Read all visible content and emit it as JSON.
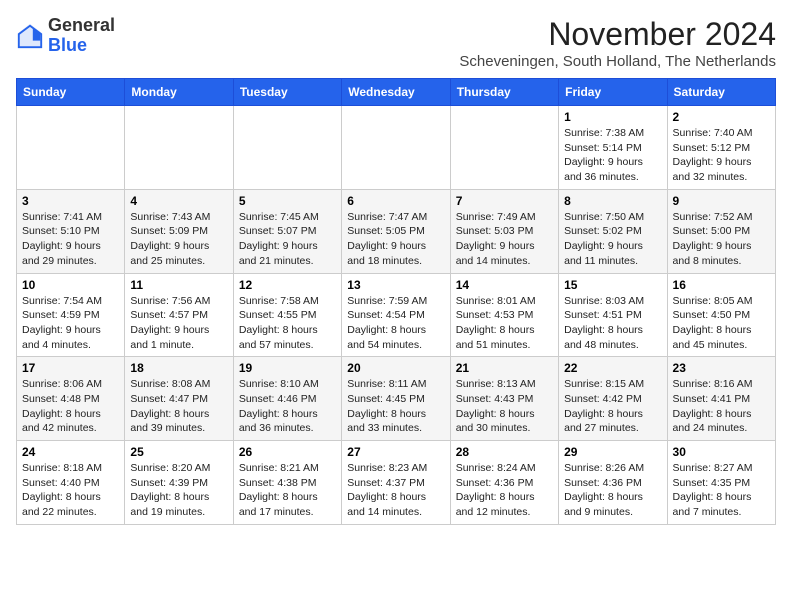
{
  "logo": {
    "line1": "General",
    "line2": "Blue"
  },
  "title": "November 2024",
  "location": "Scheveningen, South Holland, The Netherlands",
  "weekdays": [
    "Sunday",
    "Monday",
    "Tuesday",
    "Wednesday",
    "Thursday",
    "Friday",
    "Saturday"
  ],
  "weeks": [
    [
      {
        "day": "",
        "sunrise": "",
        "sunset": "",
        "daylight": ""
      },
      {
        "day": "",
        "sunrise": "",
        "sunset": "",
        "daylight": ""
      },
      {
        "day": "",
        "sunrise": "",
        "sunset": "",
        "daylight": ""
      },
      {
        "day": "",
        "sunrise": "",
        "sunset": "",
        "daylight": ""
      },
      {
        "day": "",
        "sunrise": "",
        "sunset": "",
        "daylight": ""
      },
      {
        "day": "1",
        "sunrise": "Sunrise: 7:38 AM",
        "sunset": "Sunset: 5:14 PM",
        "daylight": "Daylight: 9 hours and 36 minutes."
      },
      {
        "day": "2",
        "sunrise": "Sunrise: 7:40 AM",
        "sunset": "Sunset: 5:12 PM",
        "daylight": "Daylight: 9 hours and 32 minutes."
      }
    ],
    [
      {
        "day": "3",
        "sunrise": "Sunrise: 7:41 AM",
        "sunset": "Sunset: 5:10 PM",
        "daylight": "Daylight: 9 hours and 29 minutes."
      },
      {
        "day": "4",
        "sunrise": "Sunrise: 7:43 AM",
        "sunset": "Sunset: 5:09 PM",
        "daylight": "Daylight: 9 hours and 25 minutes."
      },
      {
        "day": "5",
        "sunrise": "Sunrise: 7:45 AM",
        "sunset": "Sunset: 5:07 PM",
        "daylight": "Daylight: 9 hours and 21 minutes."
      },
      {
        "day": "6",
        "sunrise": "Sunrise: 7:47 AM",
        "sunset": "Sunset: 5:05 PM",
        "daylight": "Daylight: 9 hours and 18 minutes."
      },
      {
        "day": "7",
        "sunrise": "Sunrise: 7:49 AM",
        "sunset": "Sunset: 5:03 PM",
        "daylight": "Daylight: 9 hours and 14 minutes."
      },
      {
        "day": "8",
        "sunrise": "Sunrise: 7:50 AM",
        "sunset": "Sunset: 5:02 PM",
        "daylight": "Daylight: 9 hours and 11 minutes."
      },
      {
        "day": "9",
        "sunrise": "Sunrise: 7:52 AM",
        "sunset": "Sunset: 5:00 PM",
        "daylight": "Daylight: 9 hours and 8 minutes."
      }
    ],
    [
      {
        "day": "10",
        "sunrise": "Sunrise: 7:54 AM",
        "sunset": "Sunset: 4:59 PM",
        "daylight": "Daylight: 9 hours and 4 minutes."
      },
      {
        "day": "11",
        "sunrise": "Sunrise: 7:56 AM",
        "sunset": "Sunset: 4:57 PM",
        "daylight": "Daylight: 9 hours and 1 minute."
      },
      {
        "day": "12",
        "sunrise": "Sunrise: 7:58 AM",
        "sunset": "Sunset: 4:55 PM",
        "daylight": "Daylight: 8 hours and 57 minutes."
      },
      {
        "day": "13",
        "sunrise": "Sunrise: 7:59 AM",
        "sunset": "Sunset: 4:54 PM",
        "daylight": "Daylight: 8 hours and 54 minutes."
      },
      {
        "day": "14",
        "sunrise": "Sunrise: 8:01 AM",
        "sunset": "Sunset: 4:53 PM",
        "daylight": "Daylight: 8 hours and 51 minutes."
      },
      {
        "day": "15",
        "sunrise": "Sunrise: 8:03 AM",
        "sunset": "Sunset: 4:51 PM",
        "daylight": "Daylight: 8 hours and 48 minutes."
      },
      {
        "day": "16",
        "sunrise": "Sunrise: 8:05 AM",
        "sunset": "Sunset: 4:50 PM",
        "daylight": "Daylight: 8 hours and 45 minutes."
      }
    ],
    [
      {
        "day": "17",
        "sunrise": "Sunrise: 8:06 AM",
        "sunset": "Sunset: 4:48 PM",
        "daylight": "Daylight: 8 hours and 42 minutes."
      },
      {
        "day": "18",
        "sunrise": "Sunrise: 8:08 AM",
        "sunset": "Sunset: 4:47 PM",
        "daylight": "Daylight: 8 hours and 39 minutes."
      },
      {
        "day": "19",
        "sunrise": "Sunrise: 8:10 AM",
        "sunset": "Sunset: 4:46 PM",
        "daylight": "Daylight: 8 hours and 36 minutes."
      },
      {
        "day": "20",
        "sunrise": "Sunrise: 8:11 AM",
        "sunset": "Sunset: 4:45 PM",
        "daylight": "Daylight: 8 hours and 33 minutes."
      },
      {
        "day": "21",
        "sunrise": "Sunrise: 8:13 AM",
        "sunset": "Sunset: 4:43 PM",
        "daylight": "Daylight: 8 hours and 30 minutes."
      },
      {
        "day": "22",
        "sunrise": "Sunrise: 8:15 AM",
        "sunset": "Sunset: 4:42 PM",
        "daylight": "Daylight: 8 hours and 27 minutes."
      },
      {
        "day": "23",
        "sunrise": "Sunrise: 8:16 AM",
        "sunset": "Sunset: 4:41 PM",
        "daylight": "Daylight: 8 hours and 24 minutes."
      }
    ],
    [
      {
        "day": "24",
        "sunrise": "Sunrise: 8:18 AM",
        "sunset": "Sunset: 4:40 PM",
        "daylight": "Daylight: 8 hours and 22 minutes."
      },
      {
        "day": "25",
        "sunrise": "Sunrise: 8:20 AM",
        "sunset": "Sunset: 4:39 PM",
        "daylight": "Daylight: 8 hours and 19 minutes."
      },
      {
        "day": "26",
        "sunrise": "Sunrise: 8:21 AM",
        "sunset": "Sunset: 4:38 PM",
        "daylight": "Daylight: 8 hours and 17 minutes."
      },
      {
        "day": "27",
        "sunrise": "Sunrise: 8:23 AM",
        "sunset": "Sunset: 4:37 PM",
        "daylight": "Daylight: 8 hours and 14 minutes."
      },
      {
        "day": "28",
        "sunrise": "Sunrise: 8:24 AM",
        "sunset": "Sunset: 4:36 PM",
        "daylight": "Daylight: 8 hours and 12 minutes."
      },
      {
        "day": "29",
        "sunrise": "Sunrise: 8:26 AM",
        "sunset": "Sunset: 4:36 PM",
        "daylight": "Daylight: 8 hours and 9 minutes."
      },
      {
        "day": "30",
        "sunrise": "Sunrise: 8:27 AM",
        "sunset": "Sunset: 4:35 PM",
        "daylight": "Daylight: 8 hours and 7 minutes."
      }
    ]
  ]
}
